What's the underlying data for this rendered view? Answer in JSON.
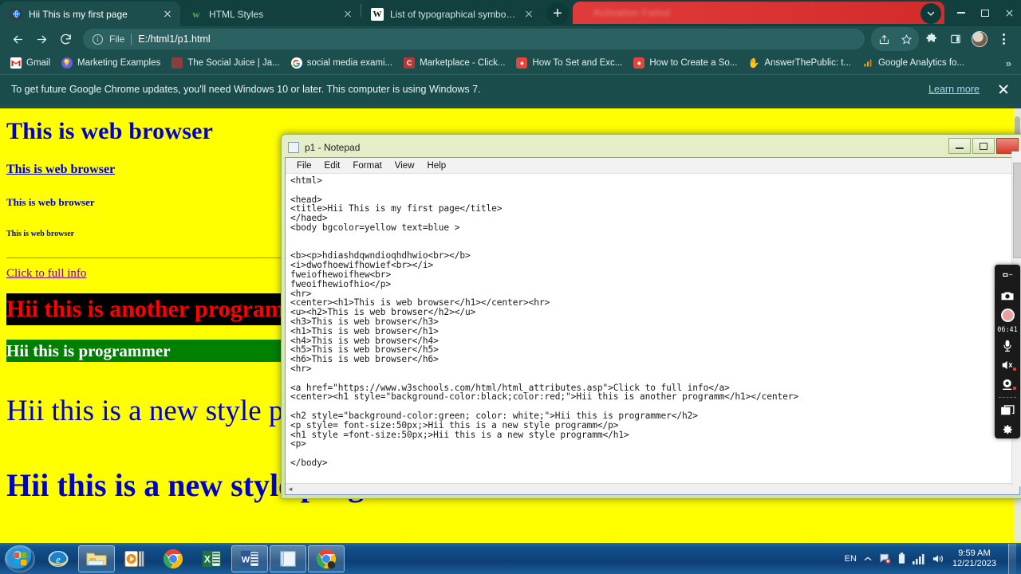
{
  "browser": {
    "tabs": [
      {
        "title": "Hii This is my first page",
        "favicon": "globe-icon",
        "active": true
      },
      {
        "title": "HTML Styles",
        "favicon": "w3schools-icon",
        "active": false
      },
      {
        "title": "List of typographical symbols an",
        "favicon": "wikipedia-icon",
        "active": false
      }
    ],
    "new_tab_label": "+",
    "notification_strip_text": "Activation Failed",
    "tab_list_chevron": "chevron-down-icon",
    "window_controls": {
      "minimize": "minimize-icon",
      "maximize": "maximize-icon",
      "close": "close-icon"
    },
    "toolbar": {
      "back": "back-arrow-icon",
      "forward": "forward-arrow-icon",
      "reload": "reload-icon",
      "info_icon": "info-circle-icon",
      "scheme_label": "File",
      "url": "E:/html1/p1.html",
      "share": "share-icon",
      "bookmark": "star-icon",
      "extensions": "puzzle-icon",
      "sidepanel": "side-panel-icon",
      "profile": "avatar-icon",
      "menu": "three-dot-menu-icon"
    },
    "bookmarks": [
      {
        "label": "Gmail",
        "icon": "gmail-icon",
        "color": "#ea4335"
      },
      {
        "label": "Marketing Examples",
        "icon": "bulb-icon",
        "color": "#6b5ce7"
      },
      {
        "label": "The Social Juice | Ja...",
        "icon": "juice-icon",
        "color": "#c04a4a"
      },
      {
        "label": "social media exami...",
        "icon": "google-icon",
        "color": "#ffffff"
      },
      {
        "label": "Marketplace - Click...",
        "icon": "clickbank-icon",
        "color": "#d93b3b"
      },
      {
        "label": "How To Set and Exc...",
        "icon": "red-owl-icon",
        "color": "#e4443a"
      },
      {
        "label": "How to Create a So...",
        "icon": "red-owl-icon",
        "color": "#e4443a"
      },
      {
        "label": "AnswerThePublic: t...",
        "icon": "hand-icon",
        "color": "#4a5de8"
      },
      {
        "label": "Google Analytics fo...",
        "icon": "analytics-icon",
        "color": "#f9ab00"
      }
    ],
    "bookmarks_overflow": "»",
    "banner": {
      "message": "To get future Google Chrome updates, you'll need Windows 10 or later. This computer is using Windows 7.",
      "link": "Learn more",
      "close": "close-icon"
    }
  },
  "page": {
    "bg_color": "#ffff00",
    "text_color": "#0000cd",
    "h1_center": "This is web browser",
    "h2_underline": "This is web browser",
    "h3": "This is web browser",
    "h4": "This is web browser",
    "link": "Click to full info",
    "black_bar": {
      "text": "Hii this is another programm",
      "bg": "#000000",
      "color": "#ff0000"
    },
    "green_bar": {
      "text": "Hii this is programmer",
      "bg": "#008000",
      "color": "#ffffff"
    },
    "p_50px": "Hii this is a new style programm",
    "h1_50px": "Hii this is a new style programm"
  },
  "notepad": {
    "title": "p1 - Notepad",
    "menu": [
      "File",
      "Edit",
      "Format",
      "View",
      "Help"
    ],
    "controls": {
      "minimize": "minimize-icon",
      "maximize": "maximize-icon",
      "close": "close-icon"
    },
    "content": "<html>\n\n<head>\n<title>Hii This is my first page</title>\n</haed>\n<body bgcolor=yellow text=blue >\n\n\n<b><p>hdiashdqwndioqhdhwio<br></b>\n<i>dwofhoewifhowief<br></i>\nfweiofhewoifhew<br>\nfweoifhewiofhio</p>\n<hr>\n<center><h1>This is web browser</h1></center><hr>\n<u><h2>This is web browser</h2></u>\n<h3>This is web browser</h3>\n<h1>This is web browser</h1>\n<h4>This is web browser</h4>\n<h5>This is web browser</h5>\n<h6>This is web browser</h6>\n<hr>\n\n<a href=\"https://www.w3schools.com/html/html_attributes.asp\">Click to full info</a>\n<center><h1 style=\"background-color:black;color:red;\">Hii this is another programm</h1></center>\n\n<h2 style=\"background-color:green; color: white;\">Hii this is programmer</h2>\n<p style= font-size:50px;>Hii this is a new style programm</p>\n<h1 style =font-size:50px;>Hii this is a new style programm</h1>\n<p>\n\n</body>"
  },
  "recorder": {
    "drag_handle": "drag-handle-icon",
    "screenshot": "camera-icon",
    "record": "record-button-icon",
    "timer": "06:41",
    "microphone": "microphone-icon",
    "speaker": "speaker-icon",
    "webcam": "webcam-icon",
    "window_select": "window-icon",
    "settings": "gear-icon"
  },
  "taskbar": {
    "start": "windows-start-orb",
    "items": [
      {
        "name": "internet-explorer",
        "open": false
      },
      {
        "name": "file-explorer",
        "open": true
      },
      {
        "name": "media-player",
        "open": false
      },
      {
        "name": "google-chrome",
        "open": false
      },
      {
        "name": "microsoft-excel",
        "open": false
      },
      {
        "name": "microsoft-word",
        "open": true
      },
      {
        "name": "notepad",
        "open": true
      },
      {
        "name": "google-chrome-window",
        "open": true
      }
    ],
    "tray": {
      "language": "EN",
      "show_hidden": "chevron-up-icon",
      "network": "network-icon",
      "battery": "battery-icon",
      "signal": "signal-icon",
      "volume": "volume-icon",
      "time": "9:59 AM",
      "date": "12/21/2023"
    }
  }
}
